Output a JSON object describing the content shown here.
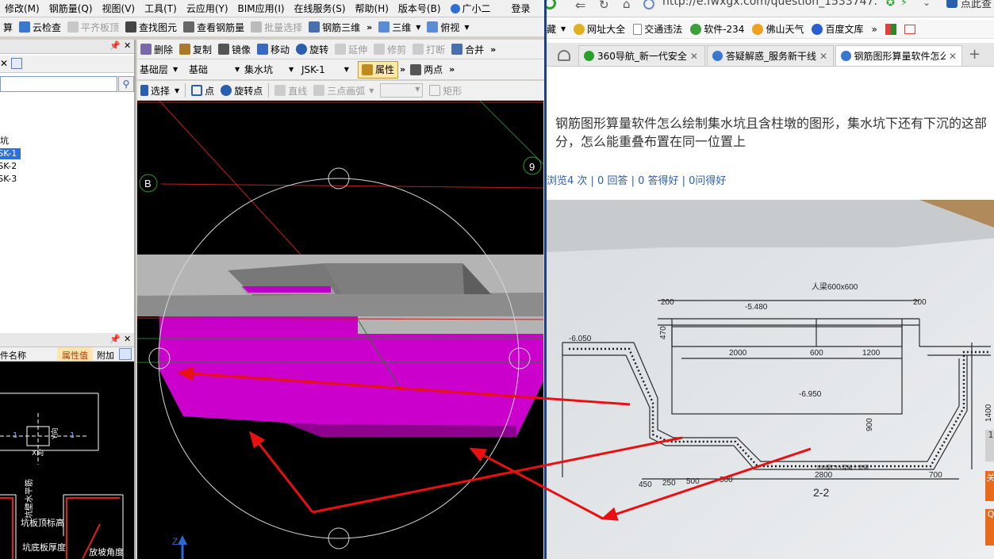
{
  "app": {
    "menu": [
      {
        "label": "修改(M)"
      },
      {
        "label": "钢筋量(Q)"
      },
      {
        "label": "视图(V)"
      },
      {
        "label": "工具(T)"
      },
      {
        "label": "云应用(Y)"
      },
      {
        "label": "BIM应用(I)"
      },
      {
        "label": "在线服务(S)"
      },
      {
        "label": "帮助(H)"
      },
      {
        "label": "版本号(B)"
      },
      {
        "label": "广小二"
      },
      {
        "label": "登录"
      }
    ],
    "toolbar1": {
      "items": [
        {
          "label": "算"
        },
        {
          "label": "云检查"
        },
        {
          "label": "平齐板顶"
        },
        {
          "label": "查找图元"
        },
        {
          "label": "查看钢筋量"
        },
        {
          "label": "批量选择"
        },
        {
          "label": "钢筋三维"
        }
      ],
      "more": "»",
      "view3d": "三维",
      "viewmode": "俯视"
    },
    "toolbar2": {
      "items": [
        {
          "label": "删除"
        },
        {
          "label": "复制"
        },
        {
          "label": "镜像"
        },
        {
          "label": "移动"
        },
        {
          "label": "旋转"
        },
        {
          "label": "延伸"
        },
        {
          "label": "修剪"
        },
        {
          "label": "打断"
        },
        {
          "label": "合并"
        }
      ],
      "more": "»"
    },
    "toolbar3": {
      "layer": "基础层",
      "category": "基础",
      "type": "集水坑",
      "element": "JSK-1",
      "properties": "属性",
      "twopoint": "两点",
      "more": "»"
    },
    "toolbar4": {
      "select": "选择",
      "point": "点",
      "rotatepoint": "旋转点",
      "line": "直线",
      "arc3": "三点画弧",
      "rect": "矩形"
    },
    "tree": {
      "items": [
        {
          "label": "坑"
        },
        {
          "label": "JSK-1"
        },
        {
          "label": "JSK-2"
        },
        {
          "label": "JSK-3"
        }
      ]
    },
    "props": {
      "col_name": "件名称",
      "col_value": "属性值",
      "col_extra": "附加"
    },
    "diagram": {
      "labels": [
        "1",
        "Y向",
        "1",
        "X向",
        "坑壁水平筋",
        "坑板顶标高",
        "坑底板厚度",
        "放坡角度"
      ]
    },
    "viewport": {
      "axis_b": "B",
      "axis_9": "9",
      "axis_z": "Z"
    }
  },
  "browser": {
    "url": "http://e.fwxgx.com/question_1533747.htm",
    "url_suffix": "点此查",
    "bookmarks": [
      {
        "label": "藏"
      },
      {
        "label": "网址大全"
      },
      {
        "label": "交通违法"
      },
      {
        "label": "软件-234"
      },
      {
        "label": "佛山天气"
      },
      {
        "label": "百度文库"
      }
    ],
    "bookmarks_more": "»",
    "tabs": [
      {
        "label": "360导航_新一代安全",
        "active": false
      },
      {
        "label": "答疑解惑_服务新干线",
        "active": false
      },
      {
        "label": "钢筋图形算量软件怎么",
        "active": true
      }
    ],
    "new_tab": "+",
    "question_title": "钢筋图形算量软件怎么绘制集水坑且含柱墩的图形，集水坑下还有下沉的这部分，怎么能重叠布置在同一位置上",
    "stats": "浏览4 次 | 0 回答 | 0 答得好 | 0问得好",
    "drawing": {
      "title": "2-2",
      "labels": [
        "人梁600x600",
        "-5.480",
        "-6.050",
        "-6.950",
        "2000",
        "600",
        "1200",
        "200",
        "200",
        "470",
        "900",
        "1400",
        "450",
        "250",
        "500",
        "500",
        "2800",
        "700",
        "100厚C15混凝土垫层"
      ]
    },
    "side_buttons": [
      "1",
      "关",
      "Q"
    ]
  }
}
